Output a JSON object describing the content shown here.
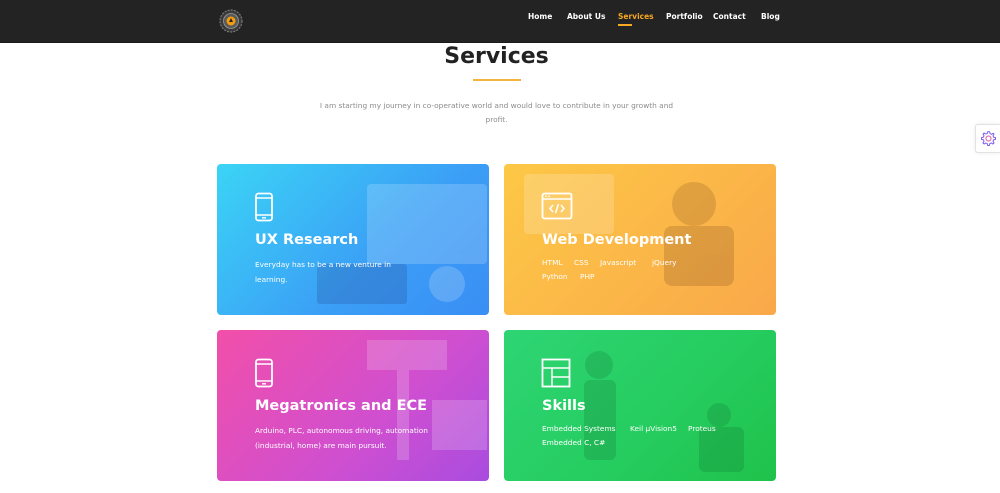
{
  "nav": {
    "logo": "logo",
    "links": [
      "Home",
      "About Us",
      "Services",
      "Portfolio",
      "Contact",
      "Blog"
    ],
    "active": "Services",
    "accent_color": "#f6a823"
  },
  "header": {
    "title": "Services",
    "subtitle": "I am starting my journey in co-operative world and would love to contribute in your growth and profit."
  },
  "settings_button": {
    "icon": "gear-icon",
    "color": "#7b5cf0"
  },
  "cards": [
    {
      "icon": "mobile-phone-icon",
      "title": "UX Research",
      "text": "Everyday has to be a new venture in learning.",
      "gradient": [
        "#3bd4f5",
        "#3a8ef5"
      ]
    },
    {
      "icon": "code-window-icon",
      "title": "Web Development",
      "tags": [
        "HTML",
        "CSS",
        "Javascript",
        "jQuery",
        "Python",
        "PHP"
      ],
      "gradient": [
        "#fdc846",
        "#f9a84a"
      ]
    },
    {
      "icon": "mobile-phone-icon",
      "title": "Megatronics and ECE",
      "text": "Arduino, PLC, autonomous driving, automation (industrial, home) are main pursuit.",
      "gradient": [
        "#f24fa9",
        "#a94ce0"
      ]
    },
    {
      "icon": "layout-icon",
      "title": "Skills",
      "tags": [
        "Embedded Systems",
        "Keil µVision5",
        "Proteus",
        "Embedded C, C#"
      ],
      "gradient": [
        "#2ed574",
        "#1fc24a"
      ]
    }
  ]
}
